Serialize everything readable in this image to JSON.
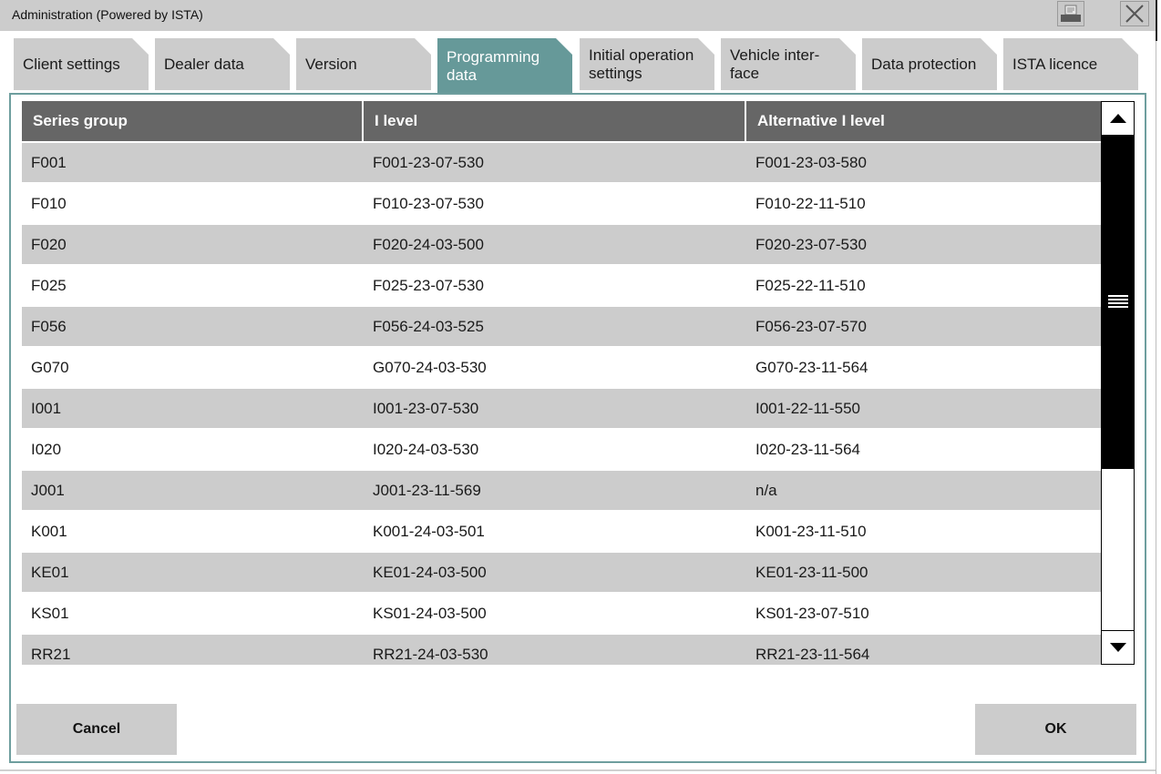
{
  "window": {
    "title": "Administration (Powered by  ISTA)",
    "print_icon": "printer-icon",
    "close_icon": "close-icon"
  },
  "tabs": [
    {
      "label": "Client settings",
      "active": false
    },
    {
      "label": "Dealer data",
      "active": false
    },
    {
      "label": "Version",
      "active": false
    },
    {
      "label": "Programming data",
      "active": true
    },
    {
      "label": "Initial operation settings",
      "active": false
    },
    {
      "label": "Vehicle inter-face",
      "active": false
    },
    {
      "label": "Data protection",
      "active": false
    },
    {
      "label": "ISTA licence",
      "active": false
    }
  ],
  "table": {
    "columns": [
      "Series group",
      "I level",
      "Alternative I level"
    ],
    "rows": [
      [
        "F001",
        "F001-23-07-530",
        "F001-23-03-580"
      ],
      [
        "F010",
        "F010-23-07-530",
        "F010-22-11-510"
      ],
      [
        "F020",
        "F020-24-03-500",
        "F020-23-07-530"
      ],
      [
        "F025",
        "F025-23-07-530",
        "F025-22-11-510"
      ],
      [
        "F056",
        "F056-24-03-525",
        "F056-23-07-570"
      ],
      [
        "G070",
        "G070-24-03-530",
        "G070-23-11-564"
      ],
      [
        "I001",
        "I001-23-07-530",
        "I001-22-11-550"
      ],
      [
        "I020",
        "I020-24-03-530",
        "I020-23-11-564"
      ],
      [
        "J001",
        "J001-23-11-569",
        "n/a"
      ],
      [
        "K001",
        "K001-24-03-501",
        "K001-23-11-510"
      ],
      [
        "KE01",
        "KE01-24-03-500",
        "KE01-23-11-500"
      ],
      [
        "KS01",
        "KS01-24-03-500",
        "KS01-23-07-510"
      ],
      [
        "RR21",
        "RR21-24-03-530",
        "RR21-23-11-564"
      ]
    ]
  },
  "scrollbar": {
    "up_icon": "triangle-up-icon",
    "down_icon": "triangle-down-icon",
    "grip_icon": "grip-lines-icon"
  },
  "buttons": {
    "cancel": "Cancel",
    "ok": "OK"
  },
  "colors": {
    "active_tab": "#669999",
    "tab": "#cccccc",
    "header": "#666666",
    "panel_border": "#6e9e9e"
  }
}
